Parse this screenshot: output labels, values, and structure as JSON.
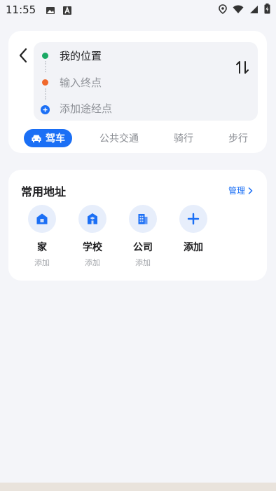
{
  "status_bar": {
    "time": "11:55",
    "left_icons": [
      "image-icon",
      "a-letter-icon"
    ],
    "right_icons": [
      "location-icon",
      "wifi-icon",
      "signal-icon",
      "battery-icon"
    ]
  },
  "route": {
    "origin": "我的位置",
    "destination_placeholder": "输入终点",
    "add_waypoint": "添加途经点",
    "colors": {
      "origin": "#1aa964",
      "destination": "#f0682b",
      "waypoint": "#1b6ff5"
    }
  },
  "modes": [
    {
      "label": "驾车",
      "active": true
    },
    {
      "label": "公共交通",
      "active": false
    },
    {
      "label": "骑行",
      "active": false
    },
    {
      "label": "步行",
      "active": false
    }
  ],
  "addresses": {
    "title": "常用地址",
    "manage_label": "管理",
    "items": [
      {
        "label": "家",
        "sub": "添加",
        "icon": "home-icon"
      },
      {
        "label": "学校",
        "sub": "添加",
        "icon": "school-icon"
      },
      {
        "label": "公司",
        "sub": "添加",
        "icon": "office-icon"
      },
      {
        "label": "添加",
        "sub": "",
        "icon": "plus-icon"
      }
    ]
  },
  "accent_color": "#1b6ff5"
}
